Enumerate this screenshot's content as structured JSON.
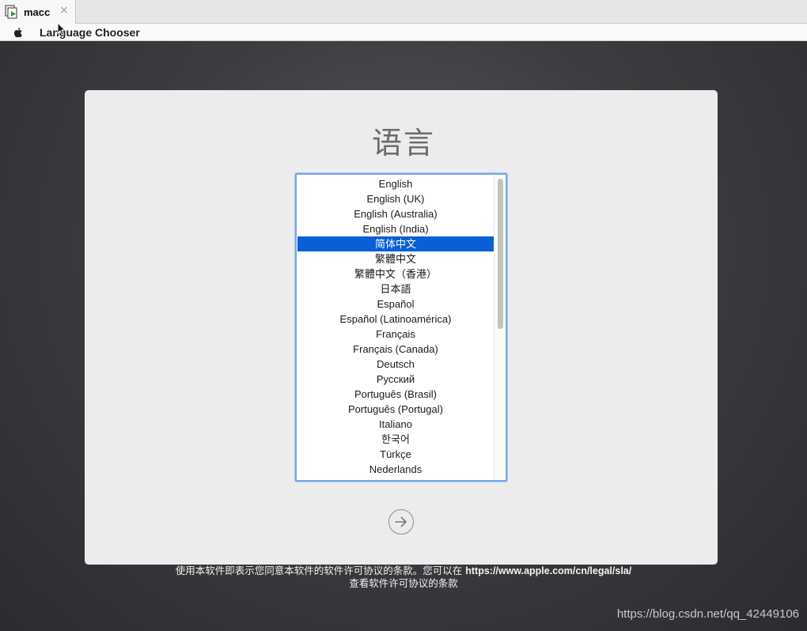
{
  "tab": {
    "label": "macc",
    "close": "×"
  },
  "menubar": {
    "app_name": "Language Chooser"
  },
  "title": "语言",
  "languages": [
    "English",
    "English (UK)",
    "English (Australia)",
    "English (India)",
    "简体中文",
    "繁體中文",
    "繁體中文（香港）",
    "日本語",
    "Español",
    "Español (Latinoamérica)",
    "Français",
    "Français (Canada)",
    "Deutsch",
    "Русский",
    "Português (Brasil)",
    "Português (Portugal)",
    "Italiano",
    "한국어",
    "Türkçe",
    "Nederlands"
  ],
  "selected_language": "简体中文",
  "license": {
    "line1_text": "使用本软件即表示您同意本软件的软件许可协议的条款。您可以在 ",
    "url": "https://www.apple.com/cn/legal/sla/",
    "line2": "查看软件许可协议的条款"
  },
  "watermark": "https://blog.csdn.net/qq_42449106",
  "icons": {
    "tab": "vm-play-icon",
    "menu": "apple-logo-icon",
    "next": "arrow-right-circle-icon",
    "cursor": "mouse-pointer-icon"
  },
  "colors": {
    "selection": "#0a5fd6",
    "focus_ring": "#7aa7e8",
    "vm_play_green": "#2e9e3e"
  }
}
